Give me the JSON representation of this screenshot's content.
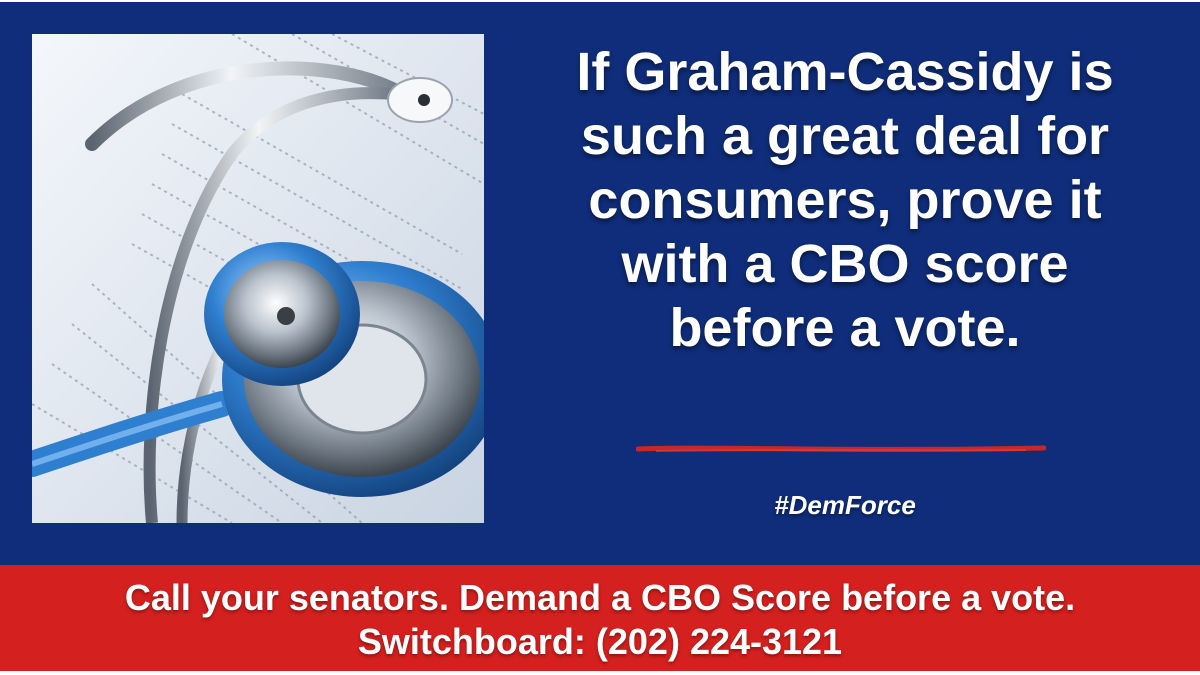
{
  "headline": {
    "lines": [
      "If Graham-Cassidy is",
      "such a great deal for",
      "consumers, prove it",
      "with a CBO score",
      "before a vote."
    ]
  },
  "hashtag": "#DemForce",
  "call_to_action": {
    "line1": "Call your senators. Demand a CBO Score before a vote.",
    "line2": "Switchboard:  (202) 224-3121"
  },
  "image": {
    "subject": "stethoscope-on-financial-report"
  },
  "colors": {
    "background": "#0f2d7a",
    "band": "#d4201e",
    "underline": "#c8262a",
    "text": "#ffffff",
    "stethoscope_blue": "#2f7fd0"
  }
}
